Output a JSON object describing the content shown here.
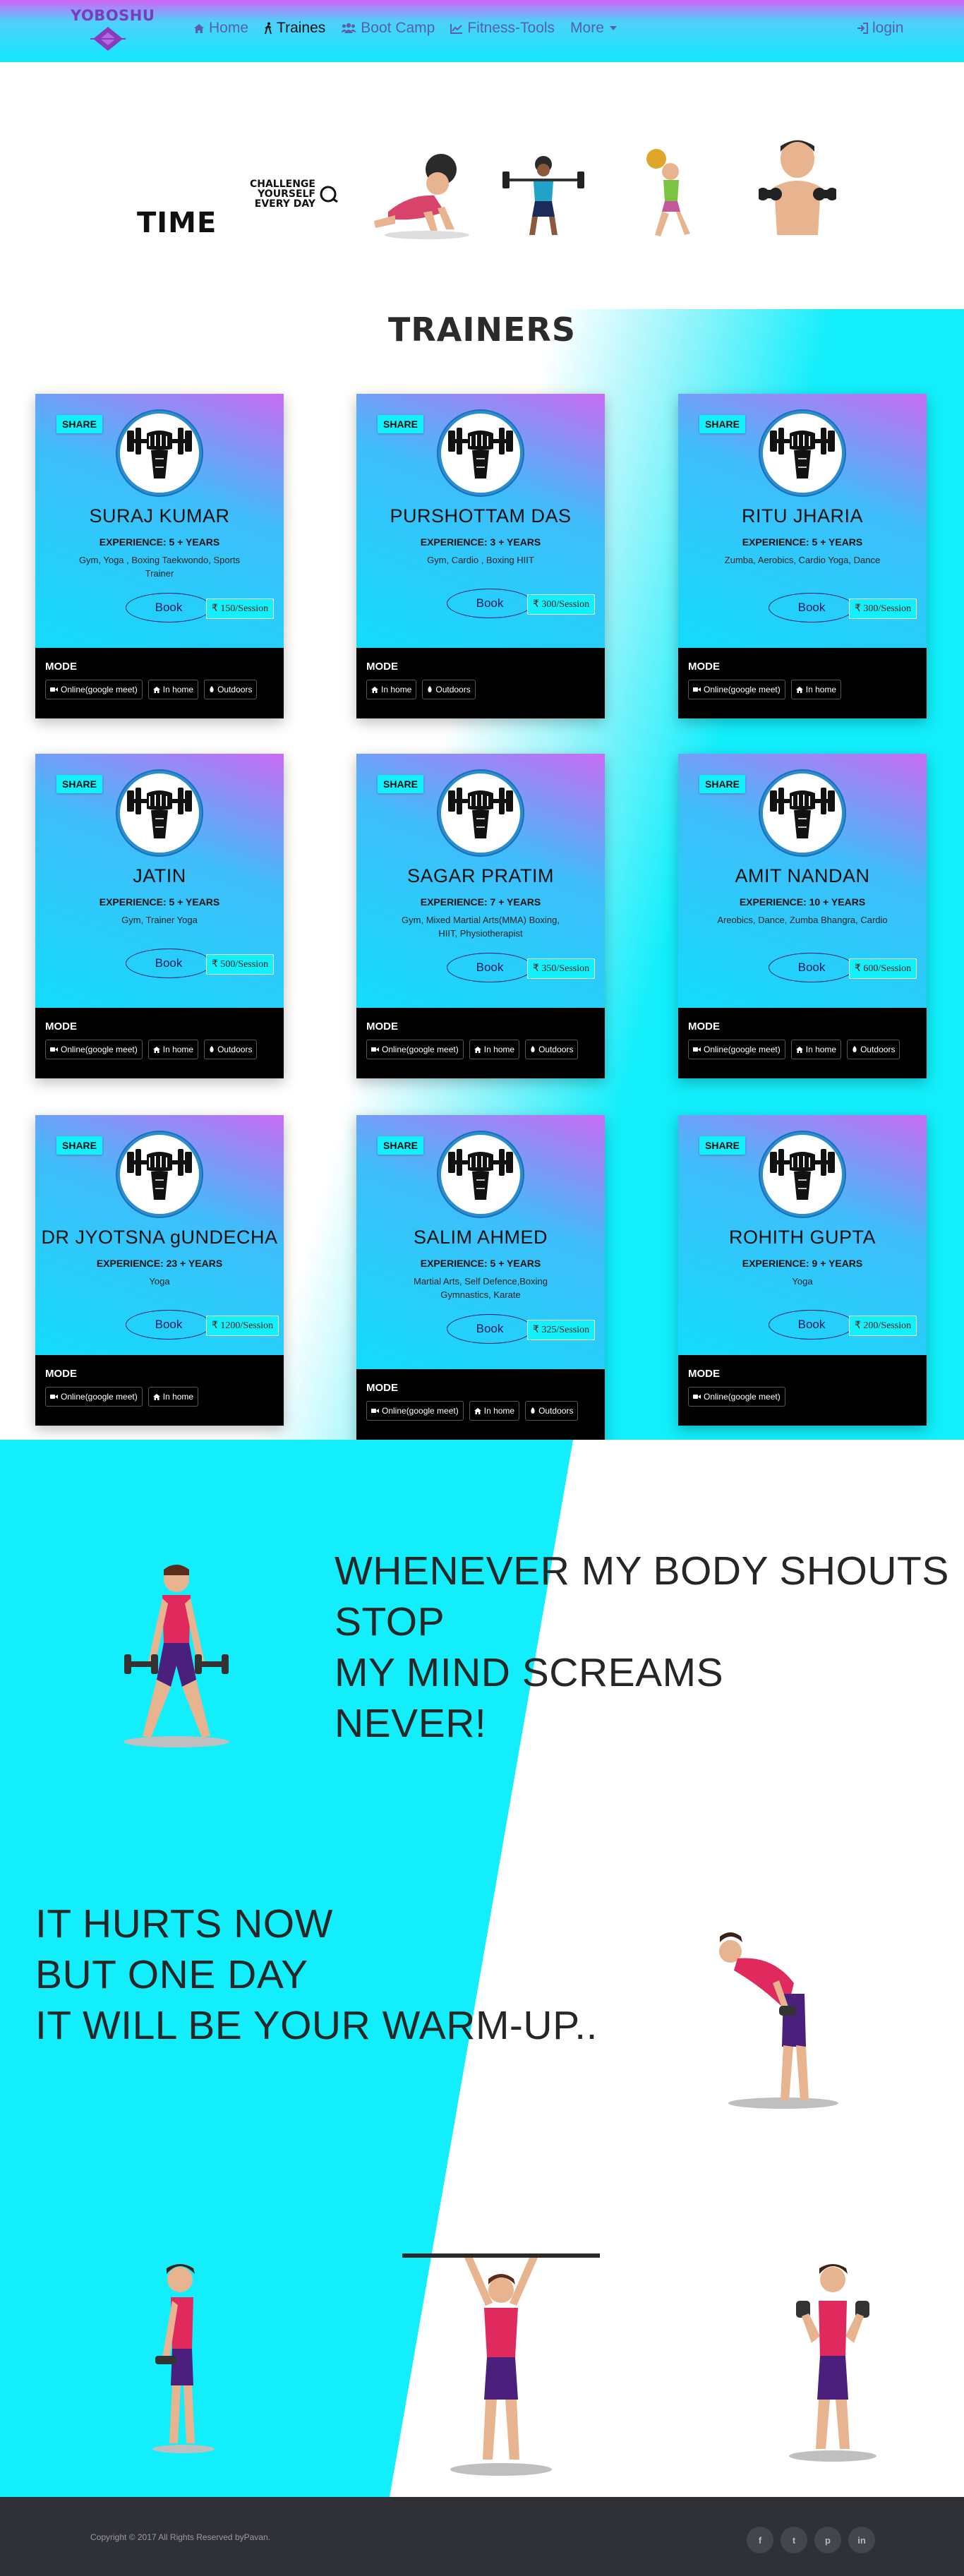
{
  "navbar": {
    "brand": "YOBOSHU",
    "items": [
      {
        "label": "Home",
        "icon": "home-icon"
      },
      {
        "label": "Traines",
        "icon": "walking-icon"
      },
      {
        "label": "Boot Camp",
        "icon": "users-icon"
      },
      {
        "label": "Fitness-Tools",
        "icon": "chart-icon"
      },
      {
        "label": "More",
        "icon": "chevron-down-icon"
      }
    ],
    "login": "login"
  },
  "hero": {
    "time": "TIME",
    "challenge": [
      "CHALLENGE",
      "YOURSELF",
      "EVERY DAY"
    ]
  },
  "trainers_title": "TRAINERS",
  "trainers": [
    {
      "share": "SHARE",
      "name": "SURAJ KUMAR",
      "experience": "EXPERIENCE: 5 + YEARS",
      "skills": "Gym, Yoga , Boxing Taekwondo, Sports Trainer",
      "book": "Book",
      "price": "₹ 150/Session",
      "mode_label": "MODE",
      "modes": [
        "Online(google meet)",
        "In home",
        "Outdoors"
      ]
    },
    {
      "share": "SHARE",
      "name": "PURSHOTTAM DAS",
      "experience": "EXPERIENCE: 3 + YEARS",
      "skills": "Gym, Cardio , Boxing HIIT",
      "book": "Book",
      "price": "₹ 300/Session",
      "mode_label": "MODE",
      "modes": [
        "In home",
        "Outdoors"
      ]
    },
    {
      "share": "SHARE",
      "name": "RITU JHARIA",
      "experience": "EXPERIENCE: 5 + YEARS",
      "skills": "Zumba, Aerobics, Cardio Yoga, Dance",
      "book": "Book",
      "price": "₹ 300/Session",
      "mode_label": "MODE",
      "modes": [
        "Online(google meet)",
        "In home"
      ]
    },
    {
      "share": "SHARE",
      "name": "JATIN",
      "experience": "EXPERIENCE: 5 + YEARS",
      "skills": "Gym, Trainer Yoga",
      "book": "Book",
      "price": "₹ 500/Session",
      "mode_label": "MODE",
      "modes": [
        "Online(google meet)",
        "In home",
        "Outdoors"
      ]
    },
    {
      "share": "SHARE",
      "name": "SAGAR PRATIM",
      "experience": "EXPERIENCE: 7 + YEARS",
      "skills": "Gym, Mixed Martial Arts(MMA) Boxing, HIIT, Physiotherapist",
      "book": "Book",
      "price": "₹ 350/Session",
      "mode_label": "MODE",
      "modes": [
        "Online(google meet)",
        "In home",
        "Outdoors"
      ]
    },
    {
      "share": "SHARE",
      "name": "AMIT NANDAN",
      "experience": "EXPERIENCE: 10 + YEARS",
      "skills": "Areobics, Dance, Zumba Bhangra, Cardio",
      "book": "Book",
      "price": "₹ 600/Session",
      "mode_label": "MODE",
      "modes": [
        "Online(google meet)",
        "In home",
        "Outdoors"
      ]
    },
    {
      "share": "SHARE",
      "name": "DR JYOTSNA gUNDECHA",
      "experience": "EXPERIENCE: 23 + YEARS",
      "skills": "Yoga",
      "book": "Book",
      "price": "₹ 1200/Session",
      "mode_label": "MODE",
      "modes": [
        "Online(google meet)",
        "In home"
      ]
    },
    {
      "share": "SHARE",
      "name": "SALIM AHMED",
      "experience": "EXPERIENCE: 5 + YEARS",
      "skills": "Martial Arts, Self Defence,Boxing Gymnastics, Karate",
      "book": "Book",
      "price": "₹ 325/Session",
      "mode_label": "MODE",
      "modes": [
        "Online(google meet)",
        "In home",
        "Outdoors"
      ]
    },
    {
      "share": "SHARE",
      "name": "ROHITH GUPTA",
      "experience": "EXPERIENCE: 9 + YEARS",
      "skills": "Yoga",
      "book": "Book",
      "price": "₹ 200/Session",
      "mode_label": "MODE",
      "modes": [
        "Online(google meet)"
      ]
    }
  ],
  "quote1": [
    "WHENEVER MY BODY SHOUTS",
    "STOP",
    "MY MIND SCREAMS",
    "NEVER!"
  ],
  "quote2": [
    "IT HURTS NOW",
    "BUT ONE DAY",
    "IT WILL BE YOUR WARM-UP.."
  ],
  "footer": {
    "copyright": "Copyright © 2017 All Rights Reserved byPavan.",
    "social": [
      {
        "icon": "facebook-icon",
        "glyph": "f"
      },
      {
        "icon": "twitter-icon",
        "glyph": "t"
      },
      {
        "icon": "pinterest-icon",
        "glyph": "p"
      },
      {
        "icon": "linkedin-icon",
        "glyph": "in"
      }
    ]
  },
  "colors": {
    "accent_cyan": "#12eefb",
    "accent_purple": "#c96cf3",
    "footer": "#2f3137"
  }
}
